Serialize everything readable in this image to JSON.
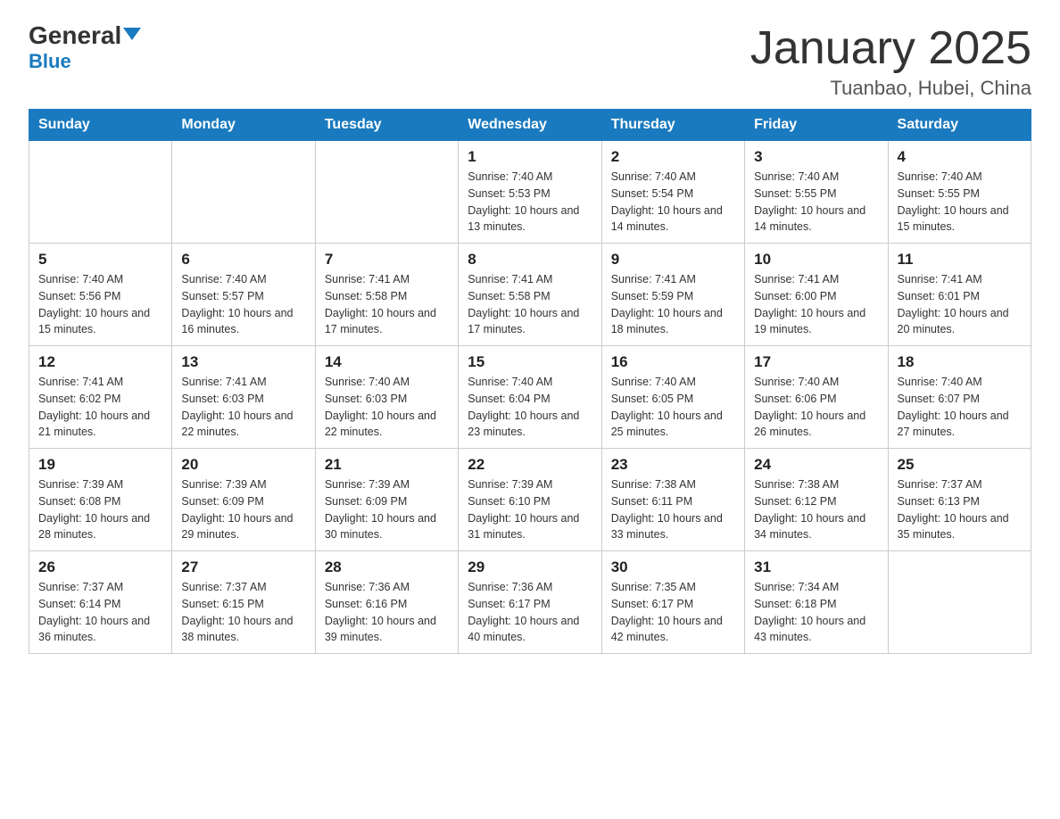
{
  "header": {
    "logo_general": "General",
    "logo_blue": "Blue",
    "month_title": "January 2025",
    "location": "Tuanbao, Hubei, China"
  },
  "days_of_week": [
    "Sunday",
    "Monday",
    "Tuesday",
    "Wednesday",
    "Thursday",
    "Friday",
    "Saturday"
  ],
  "weeks": [
    [
      null,
      null,
      null,
      {
        "day": 1,
        "sunrise": "7:40 AM",
        "sunset": "5:53 PM",
        "daylight": "10 hours and 13 minutes."
      },
      {
        "day": 2,
        "sunrise": "7:40 AM",
        "sunset": "5:54 PM",
        "daylight": "10 hours and 14 minutes."
      },
      {
        "day": 3,
        "sunrise": "7:40 AM",
        "sunset": "5:55 PM",
        "daylight": "10 hours and 14 minutes."
      },
      {
        "day": 4,
        "sunrise": "7:40 AM",
        "sunset": "5:55 PM",
        "daylight": "10 hours and 15 minutes."
      }
    ],
    [
      {
        "day": 5,
        "sunrise": "7:40 AM",
        "sunset": "5:56 PM",
        "daylight": "10 hours and 15 minutes."
      },
      {
        "day": 6,
        "sunrise": "7:40 AM",
        "sunset": "5:57 PM",
        "daylight": "10 hours and 16 minutes."
      },
      {
        "day": 7,
        "sunrise": "7:41 AM",
        "sunset": "5:58 PM",
        "daylight": "10 hours and 17 minutes."
      },
      {
        "day": 8,
        "sunrise": "7:41 AM",
        "sunset": "5:58 PM",
        "daylight": "10 hours and 17 minutes."
      },
      {
        "day": 9,
        "sunrise": "7:41 AM",
        "sunset": "5:59 PM",
        "daylight": "10 hours and 18 minutes."
      },
      {
        "day": 10,
        "sunrise": "7:41 AM",
        "sunset": "6:00 PM",
        "daylight": "10 hours and 19 minutes."
      },
      {
        "day": 11,
        "sunrise": "7:41 AM",
        "sunset": "6:01 PM",
        "daylight": "10 hours and 20 minutes."
      }
    ],
    [
      {
        "day": 12,
        "sunrise": "7:41 AM",
        "sunset": "6:02 PM",
        "daylight": "10 hours and 21 minutes."
      },
      {
        "day": 13,
        "sunrise": "7:41 AM",
        "sunset": "6:03 PM",
        "daylight": "10 hours and 22 minutes."
      },
      {
        "day": 14,
        "sunrise": "7:40 AM",
        "sunset": "6:03 PM",
        "daylight": "10 hours and 22 minutes."
      },
      {
        "day": 15,
        "sunrise": "7:40 AM",
        "sunset": "6:04 PM",
        "daylight": "10 hours and 23 minutes."
      },
      {
        "day": 16,
        "sunrise": "7:40 AM",
        "sunset": "6:05 PM",
        "daylight": "10 hours and 25 minutes."
      },
      {
        "day": 17,
        "sunrise": "7:40 AM",
        "sunset": "6:06 PM",
        "daylight": "10 hours and 26 minutes."
      },
      {
        "day": 18,
        "sunrise": "7:40 AM",
        "sunset": "6:07 PM",
        "daylight": "10 hours and 27 minutes."
      }
    ],
    [
      {
        "day": 19,
        "sunrise": "7:39 AM",
        "sunset": "6:08 PM",
        "daylight": "10 hours and 28 minutes."
      },
      {
        "day": 20,
        "sunrise": "7:39 AM",
        "sunset": "6:09 PM",
        "daylight": "10 hours and 29 minutes."
      },
      {
        "day": 21,
        "sunrise": "7:39 AM",
        "sunset": "6:09 PM",
        "daylight": "10 hours and 30 minutes."
      },
      {
        "day": 22,
        "sunrise": "7:39 AM",
        "sunset": "6:10 PM",
        "daylight": "10 hours and 31 minutes."
      },
      {
        "day": 23,
        "sunrise": "7:38 AM",
        "sunset": "6:11 PM",
        "daylight": "10 hours and 33 minutes."
      },
      {
        "day": 24,
        "sunrise": "7:38 AM",
        "sunset": "6:12 PM",
        "daylight": "10 hours and 34 minutes."
      },
      {
        "day": 25,
        "sunrise": "7:37 AM",
        "sunset": "6:13 PM",
        "daylight": "10 hours and 35 minutes."
      }
    ],
    [
      {
        "day": 26,
        "sunrise": "7:37 AM",
        "sunset": "6:14 PM",
        "daylight": "10 hours and 36 minutes."
      },
      {
        "day": 27,
        "sunrise": "7:37 AM",
        "sunset": "6:15 PM",
        "daylight": "10 hours and 38 minutes."
      },
      {
        "day": 28,
        "sunrise": "7:36 AM",
        "sunset": "6:16 PM",
        "daylight": "10 hours and 39 minutes."
      },
      {
        "day": 29,
        "sunrise": "7:36 AM",
        "sunset": "6:17 PM",
        "daylight": "10 hours and 40 minutes."
      },
      {
        "day": 30,
        "sunrise": "7:35 AM",
        "sunset": "6:17 PM",
        "daylight": "10 hours and 42 minutes."
      },
      {
        "day": 31,
        "sunrise": "7:34 AM",
        "sunset": "6:18 PM",
        "daylight": "10 hours and 43 minutes."
      },
      null
    ]
  ]
}
